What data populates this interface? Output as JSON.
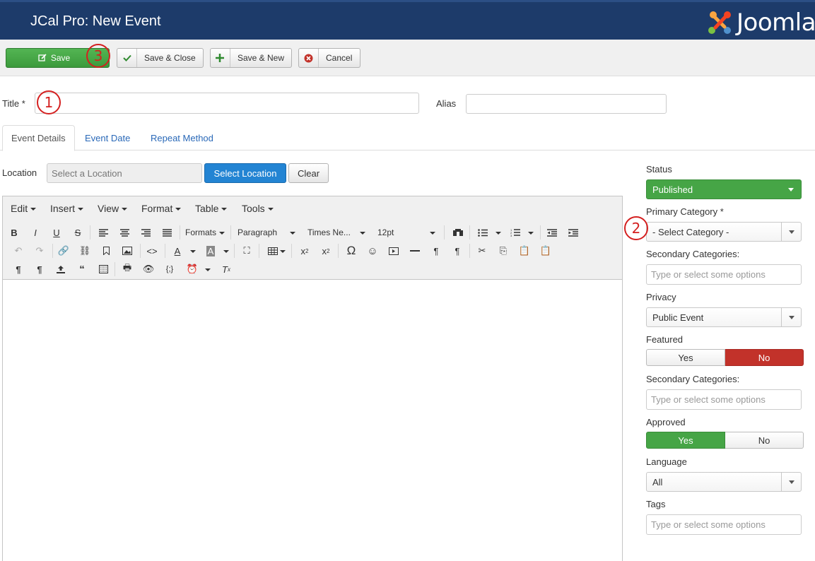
{
  "header": {
    "title": "JCal Pro: New Event",
    "brand": "Joomla",
    "logo_icon": "joomla-logo-icon"
  },
  "toolbar": {
    "save": "Save",
    "save_close": "Save & Close",
    "save_new": "Save & New",
    "cancel": "Cancel"
  },
  "annotations": {
    "one": "1",
    "two": "2",
    "three": "3"
  },
  "form": {
    "title_label": "Title *",
    "title_value": "",
    "alias_label": "Alias",
    "alias_value": ""
  },
  "tabs": [
    {
      "label": "Event Details",
      "active": true
    },
    {
      "label": "Event Date",
      "active": false
    },
    {
      "label": "Repeat Method",
      "active": false
    }
  ],
  "location": {
    "label": "Location",
    "placeholder": "Select a Location",
    "select_btn": "Select Location",
    "clear_btn": "Clear"
  },
  "editor": {
    "menus": [
      "Edit",
      "Insert",
      "View",
      "Format",
      "Table",
      "Tools"
    ],
    "formats": "Formats",
    "block": "Paragraph",
    "font": "Times Ne...",
    "size": "12pt"
  },
  "sidebar": {
    "status_label": "Status",
    "status_value": "Published",
    "primary_category_label": "Primary Category *",
    "primary_category_value": "- Select Category -",
    "secondary_categories_label": "Secondary Categories:",
    "secondary_categories_placeholder": "Type or select some options",
    "privacy_label": "Privacy",
    "privacy_value": "Public Event",
    "featured_label": "Featured",
    "featured_yes": "Yes",
    "featured_no": "No",
    "featured_value": "No",
    "secondary_categories_label_2": "Secondary Categories:",
    "secondary_categories_placeholder_2": "Type or select some options",
    "approved_label": "Approved",
    "approved_yes": "Yes",
    "approved_no": "No",
    "approved_value": "Yes",
    "language_label": "Language",
    "language_value": "All",
    "tags_label": "Tags",
    "tags_placeholder": "Type or select some options"
  },
  "colors": {
    "header_bg": "#1d3b6a",
    "primary": "#2384d3",
    "success": "#46a546",
    "danger": "#c2322a",
    "annotation": "#d42020"
  }
}
